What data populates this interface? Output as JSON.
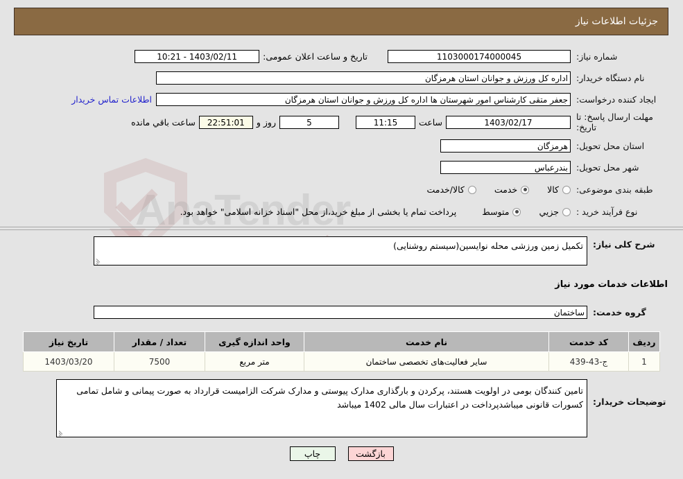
{
  "header": {
    "title": "جزئیات اطلاعات نیاز",
    "bg_color": "#8a6a43"
  },
  "form": {
    "need_number_label": "شماره نیاز:",
    "need_number_value": "1103000174000045",
    "announce_datetime_label": "تاریخ و ساعت اعلان عمومی:",
    "announce_datetime_value": "1403/02/11 - 10:21",
    "buyer_org_label": "نام دستگاه خریدار:",
    "buyer_org_value": "اداره کل ورزش و جوانان استان هرمزگان",
    "requester_label": "ایجاد کننده درخواست:",
    "requester_value": "جعفر متقی کارشناس امور شهرستان ها اداره کل ورزش و جوانان استان هرمزگان",
    "contact_link": "اطلاعات تماس خریدار",
    "deadline_label": "مهلت ارسال پاسخ: تا تاریخ:",
    "deadline_date": "1403/02/17",
    "deadline_hour_label": "ساعت",
    "deadline_hour_value": "11:15",
    "remaining_days_value": "5",
    "remaining_days_label": "روز و",
    "remaining_time_value": "22:51:01",
    "remaining_time_label": "ساعت باقي مانده",
    "province_label": "استان محل تحویل:",
    "province_value": "هرمزگان",
    "city_label": "شهر محل تحویل:",
    "city_value": "بندرعباس",
    "category_label": "طبقه بندی موضوعی:",
    "category_options": [
      {
        "label": "کالا",
        "selected": false
      },
      {
        "label": "خدمت",
        "selected": true
      },
      {
        "label": "کالا/خدمت",
        "selected": false
      }
    ],
    "process_label": "نوع فرآیند خرید :",
    "process_options": [
      {
        "label": "جزیي",
        "selected": false
      },
      {
        "label": "متوسط",
        "selected": true
      }
    ],
    "treasury_note": "پرداخت تمام یا بخشی از مبلغ خرید،از محل \"اسناد خزانه اسلامی\" خواهد بود."
  },
  "description": {
    "label": "شرح کلی نیاز:",
    "value": "تکمیل زمین ورزشی محله نوایسین(سیستم روشنایی)"
  },
  "services": {
    "section_title": "اطلاعات خدمات مورد نیاز",
    "group_label": "گروه خدمت:",
    "group_value": "ساختمان",
    "columns": [
      "ردیف",
      "کد خدمت",
      "نام خدمت",
      "واحد اندازه گیری",
      "تعداد / مقدار",
      "تاریخ نیاز"
    ],
    "rows": [
      {
        "index": "1",
        "code": "ج-43-439",
        "name": "سایر فعالیت‌های تخصصی ساختمان",
        "unit": "متر مربع",
        "quantity": "7500",
        "need_date": "1403/03/20"
      }
    ]
  },
  "buyer_notes": {
    "label": "توضیحات خریدار:",
    "value": "تامین کنندگان بومی در اولویت هستند، پرکردن و بارگذاری مدارک پیوستی و مدارک شرکت الزامیست قرارداد به صورت پیمانی و شامل تمامی کسورات قانونی میباشدپرداخت در اعتبارات سال مالی 1402 میباشد"
  },
  "footer": {
    "print_label": "چاپ",
    "back_label": "بازگشت"
  }
}
